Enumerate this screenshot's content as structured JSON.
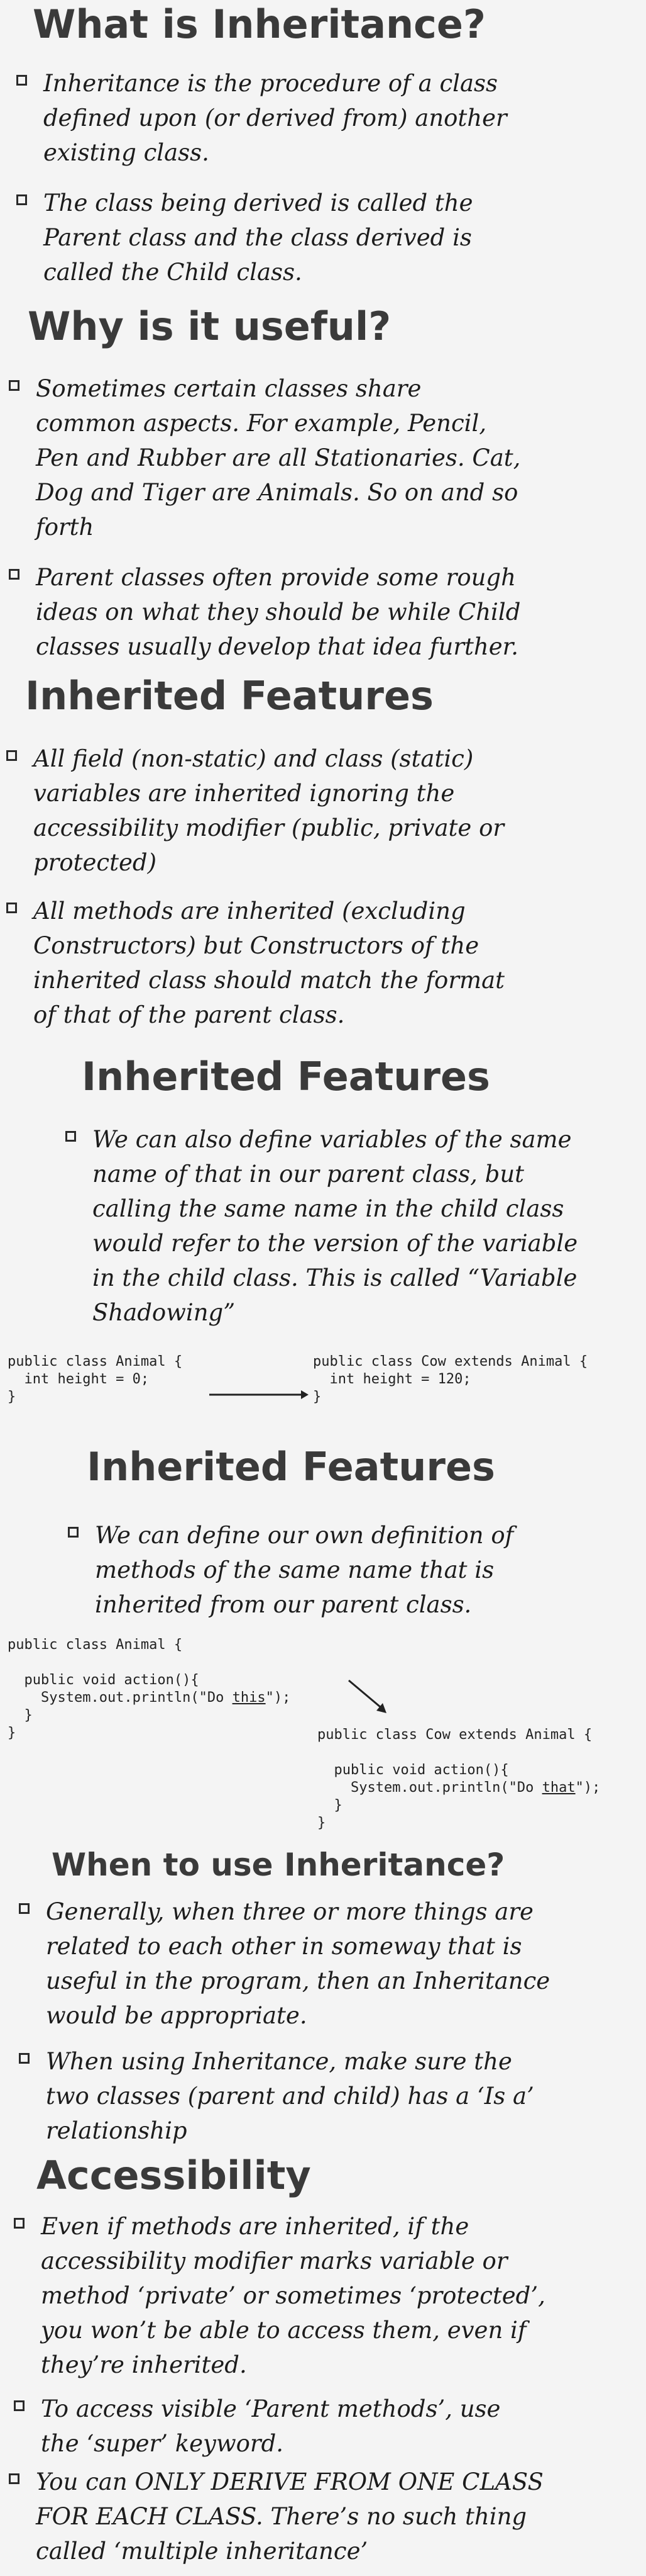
{
  "sections": [
    {
      "title": "What is Inheritance?",
      "bullets": [
        "Inheritance is the procedure of a class defined upon (or derived from) another existing class.",
        "The class being derived is called the Parent class and the class derived is called the Child class."
      ]
    },
    {
      "title": "Why is it useful?",
      "bullets": [
        "Sometimes certain classes share common aspects. For example, Pencil, Pen and Rubber are all Stationaries. Cat, Dog and Tiger are Animals. So on and so forth",
        "Parent classes often provide some rough ideas on what they should be while Child classes usually develop that idea further."
      ]
    },
    {
      "title": "Inherited Features",
      "bullets": [
        "All field (non-static) and class (static) variables are inherited ignoring the accessibility modifier (public, private or protected)",
        "All methods are inherited (excluding Constructors) but Constructors of the inherited class should match the format of that of the parent class."
      ]
    },
    {
      "title": "Inherited Features",
      "bullets": [
        "We can also define variables of the same name of that in our parent class, but calling the same name in the child class would refer to the version of the variable in the child class. This is called “Variable Shadowing”"
      ],
      "code_left": {
        "line1": "public class Animal {",
        "line2": "  int height = 0;",
        "line3": "}"
      },
      "code_right": {
        "line1": "public class Cow extends Animal {",
        "line2": "  int height = 120;",
        "line3": "}"
      }
    },
    {
      "title": "Inherited Features",
      "bullets": [
        "We can define our own definition of methods of the same name that is inherited from our parent class."
      ],
      "code_left": {
        "line1": "public class Animal {",
        "line2": "  public void action(){",
        "line3a": "    System.out.println(\"Do ",
        "line3u": "this",
        "line3b": "\");",
        "line4": "  }",
        "line5": "}"
      },
      "code_right": {
        "line1": "public class Cow extends Animal {",
        "line2": "  public void action(){",
        "line3a": "    System.out.println(\"Do ",
        "line3u": "that",
        "line3b": "\");",
        "line4": "  }",
        "line5": "}"
      }
    },
    {
      "title": "When to use Inheritance?",
      "bullets": [
        "Generally, when three or more things are related to each other in someway that is useful in the program, then an Inheritance would be appropriate.",
        "When using Inheritance, make sure the two classes (parent and child) has a ‘Is a’ relationship"
      ]
    },
    {
      "title": "Accessibility",
      "bullets": [
        "Even if methods are inherited, if the accessibility modifier marks variable or method ‘private’ or sometimes ‘protected’, you won’t be able to access them, even if they’re inherited.",
        "To access visible ‘Parent methods’, use the ‘super’ keyword.",
        "You can ONLY DERIVE FROM ONE CLASS FOR EACH CLASS. There’s no such thing called ‘multiple inheritance’"
      ]
    }
  ]
}
